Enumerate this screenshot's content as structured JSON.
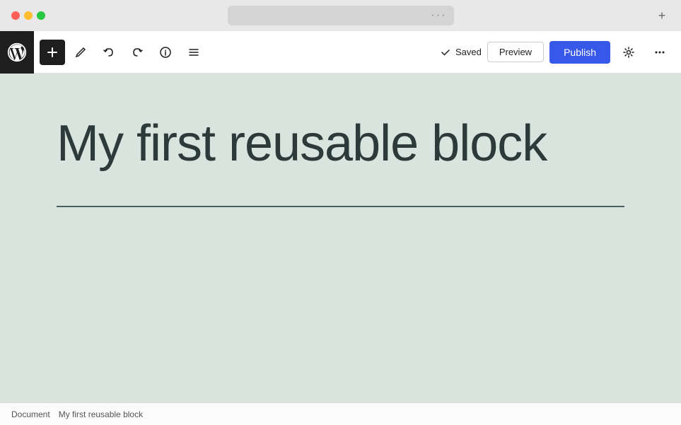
{
  "titlebar": {
    "traffic_lights": [
      "red",
      "yellow",
      "green"
    ],
    "nav_back_label": "‹",
    "nav_forward_label": "›",
    "new_tab_label": "+",
    "address_bar_dots": "···"
  },
  "toolbar": {
    "wp_logo_alt": "WordPress logo",
    "add_button_label": "+",
    "edit_icon_alt": "Edit",
    "undo_icon_alt": "Undo",
    "redo_icon_alt": "Redo",
    "info_icon_alt": "Info",
    "list_icon_alt": "List view",
    "saved_status": "Saved",
    "preview_label": "Preview",
    "publish_label": "Publish",
    "settings_icon_alt": "Settings",
    "more_icon_alt": "More"
  },
  "canvas": {
    "title": "My first reusable block"
  },
  "bottom_panel": {
    "document_label": "Document",
    "mini_title": "My first reusable block"
  }
}
